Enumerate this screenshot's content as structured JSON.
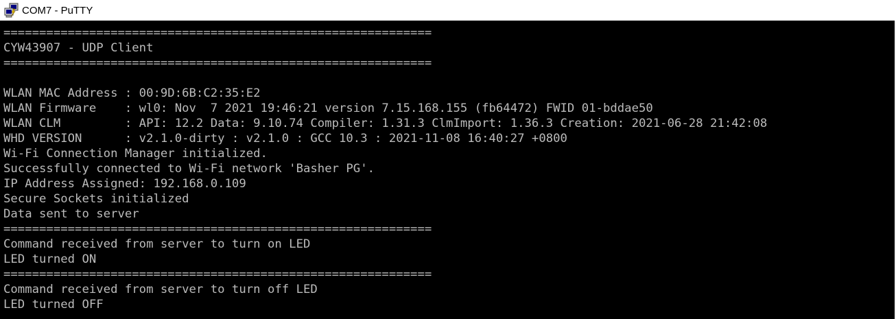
{
  "window": {
    "title": "COM7 - PuTTY",
    "icon": "putty-terminal-icon"
  },
  "colors": {
    "terminal_bg": "#000000",
    "terminal_fg": "#bbbbbb",
    "titlebar_bg": "#ffffff"
  },
  "terminal": {
    "lines": [
      "============================================================",
      "CYW43907 - UDP Client",
      "============================================================",
      "",
      "WLAN MAC Address : 00:9D:6B:C2:35:E2",
      "WLAN Firmware    : wl0: Nov  7 2021 19:46:21 version 7.15.168.155 (fb64472) FWID 01-bddae50",
      "WLAN CLM         : API: 12.2 Data: 9.10.74 Compiler: 1.31.3 ClmImport: 1.36.3 Creation: 2021-06-28 21:42:08",
      "WHD VERSION      : v2.1.0-dirty : v2.1.0 : GCC 10.3 : 2021-11-08 16:40:27 +0800",
      "Wi-Fi Connection Manager initialized.",
      "Successfully connected to Wi-Fi network 'Basher PG'.",
      "IP Address Assigned: 192.168.0.109",
      "Secure Sockets initialized",
      "Data sent to server",
      "============================================================",
      "Command received from server to turn on LED",
      "LED turned ON",
      "============================================================",
      "Command received from server to turn off LED",
      "LED turned OFF"
    ]
  }
}
